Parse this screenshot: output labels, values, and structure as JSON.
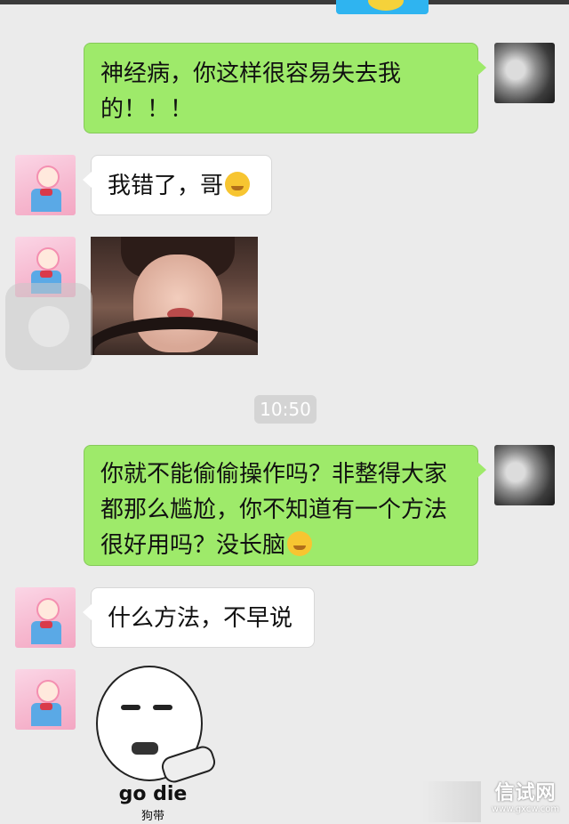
{
  "messages": [
    {
      "side": "right",
      "type": "text",
      "text": "神经病，你这样很容易失去我的！！！"
    },
    {
      "side": "left",
      "type": "text",
      "text": "我错了，哥",
      "emoji": "hugging-face-icon"
    },
    {
      "side": "left",
      "type": "image",
      "content": "photo-pouting-girl"
    },
    {
      "side": "right",
      "type": "text",
      "text": "你就不能偷偷操作吗？非整得大家都那么尴尬，你不知道有一个方法很好用吗？没长脑",
      "emoji": "crying-laughing-face-icon"
    },
    {
      "side": "left",
      "type": "text",
      "text": "什么方法，不早说"
    },
    {
      "side": "left",
      "type": "sticker",
      "caption": "go die",
      "subcaption": "狗带"
    }
  ],
  "timestamp": "10:50",
  "watermark": {
    "name": "信试网",
    "url": "www.gxcw.com"
  },
  "colors": {
    "background": "#ebebeb",
    "sent_bubble": "#9eea6a",
    "received_bubble": "#ffffff",
    "timestamp_pill": "#d4d4d4"
  }
}
